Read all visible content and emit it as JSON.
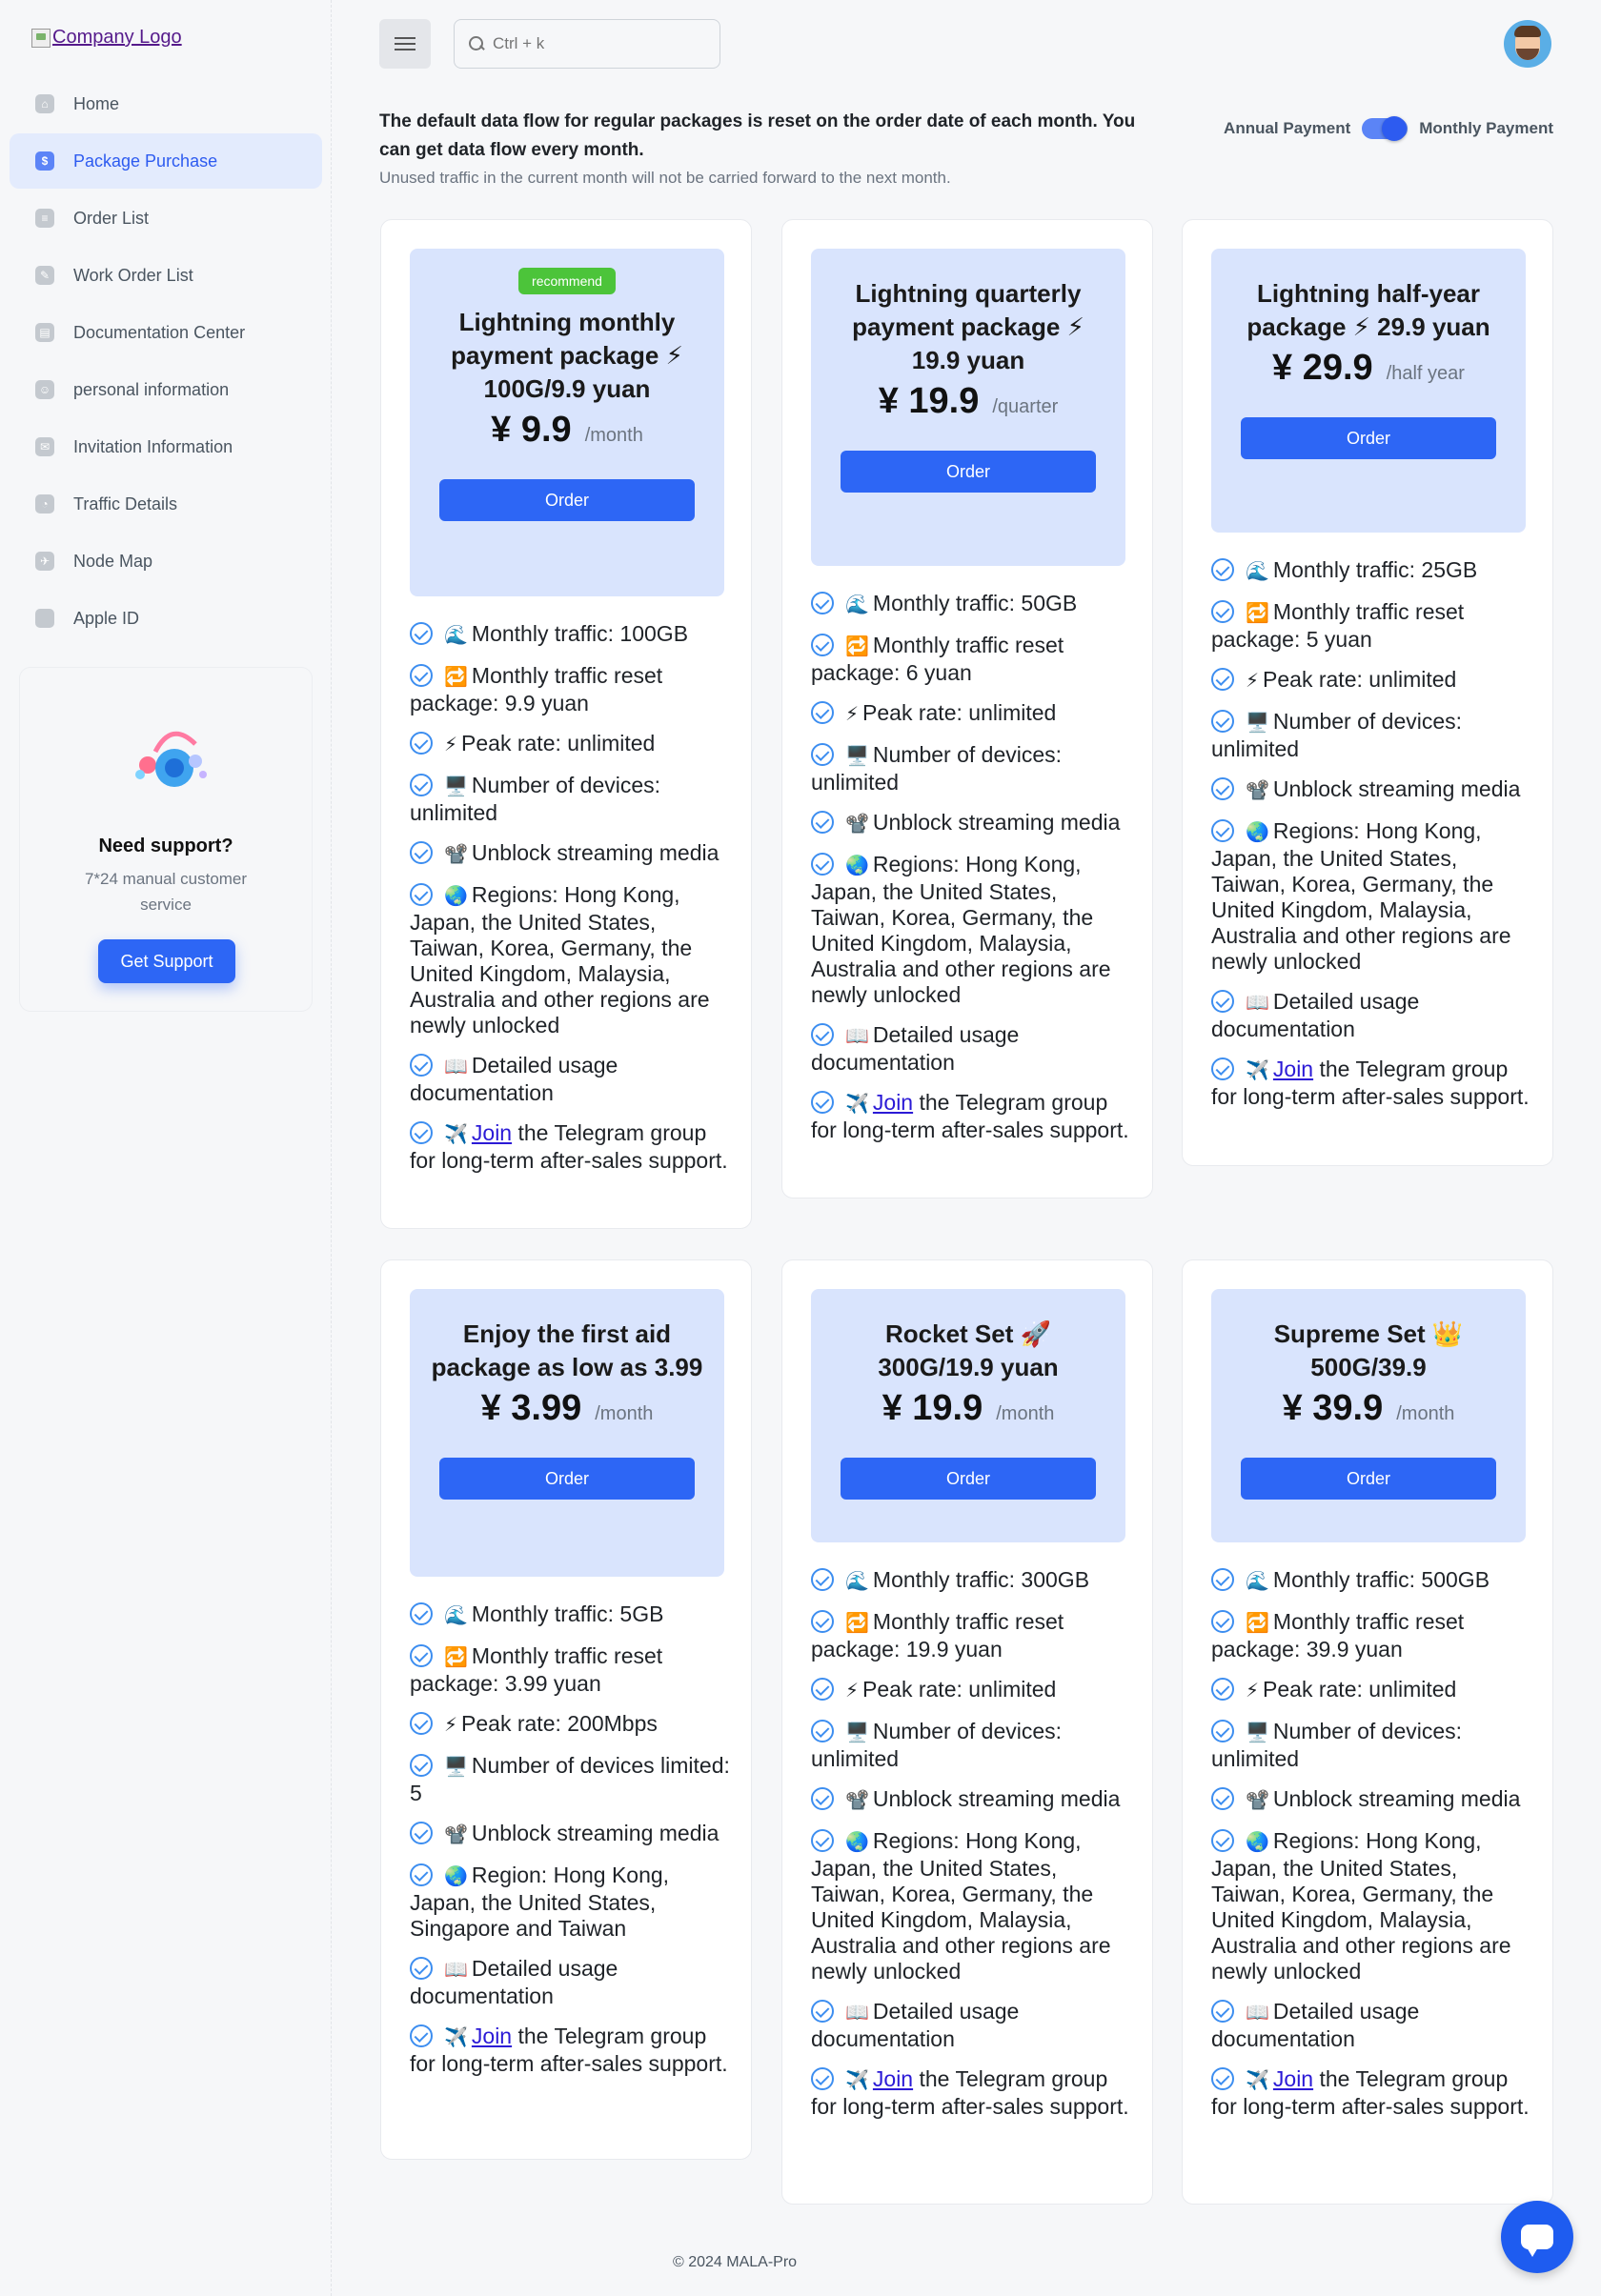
{
  "logo_alt": "Company Logo",
  "sidebar": {
    "items": [
      {
        "label": "Home",
        "icon": "home-icon"
      },
      {
        "label": "Package Purchase",
        "icon": "dollar-icon",
        "active": true
      },
      {
        "label": "Order List",
        "icon": "list-icon"
      },
      {
        "label": "Work Order List",
        "icon": "ticket-icon"
      },
      {
        "label": "Documentation Center",
        "icon": "document-icon"
      },
      {
        "label": "personal information",
        "icon": "user-icon"
      },
      {
        "label": "Invitation Information",
        "icon": "invite-icon"
      },
      {
        "label": "Traffic Details",
        "icon": "pie-chart-icon"
      },
      {
        "label": "Node Map",
        "icon": "plane-icon"
      },
      {
        "label": "Apple ID",
        "icon": "apple-icon"
      }
    ]
  },
  "support": {
    "title": "Need support?",
    "subtitle": "7*24 manual customer service",
    "button": "Get Support"
  },
  "search": {
    "placeholder": "Ctrl + k"
  },
  "intro": {
    "main": "The default data flow for regular packages is reset on the order date of each month. You can get data flow every month.",
    "sub": "Unused traffic in the current month will not be carried forward to the next month."
  },
  "toggle": {
    "left": "Annual Payment",
    "right": "Monthly Payment",
    "state": "monthly"
  },
  "order_label": "Order",
  "footer": "© 2024 MALA-Pro",
  "colors": {
    "accent": "#2d66f5",
    "card_head": "#d9e4fd",
    "badge": "#4cc43a"
  },
  "plans": [
    {
      "badge": "recommend",
      "title": "Lightning monthly payment package ⚡ 100G/9.9 yuan",
      "price": "¥ 9.9",
      "period": "/month",
      "features": [
        {
          "emoji": "🌊",
          "text": "Monthly traffic: 100GB"
        },
        {
          "emoji": "🔁",
          "text": "Monthly traffic reset package: 9.9 yuan"
        },
        {
          "emoji": "⚡",
          "text": "Peak rate: unlimited"
        },
        {
          "emoji": "🖥️",
          "text": "Number of devices: unlimited"
        },
        {
          "emoji": "📽️",
          "text": "Unblock streaming media"
        },
        {
          "emoji": "🌏",
          "text": "Regions: Hong Kong, Japan, the United States, Taiwan, Korea, Germany, the United Kingdom, Malaysia, Australia and other regions are newly unlocked"
        },
        {
          "emoji": "📖",
          "text": "Detailed usage documentation"
        },
        {
          "emoji": "✈️",
          "link": "Join",
          "text": " the Telegram group for long-term after-sales support."
        }
      ]
    },
    {
      "badge": "",
      "title": "Lightning quarterly payment package ⚡ 19.9 yuan",
      "price": "¥ 19.9",
      "period": "/quarter",
      "features": [
        {
          "emoji": "🌊",
          "text": "Monthly traffic: 50GB"
        },
        {
          "emoji": "🔁",
          "text": "Monthly traffic reset package: 6 yuan"
        },
        {
          "emoji": "⚡",
          "text": "Peak rate: unlimited"
        },
        {
          "emoji": "🖥️",
          "text": "Number of devices: unlimited"
        },
        {
          "emoji": "📽️",
          "text": "Unblock streaming media"
        },
        {
          "emoji": "🌏",
          "text": "Regions: Hong Kong, Japan, the United States, Taiwan, Korea, Germany, the United Kingdom, Malaysia, Australia and other regions are newly unlocked"
        },
        {
          "emoji": "📖",
          "text": "Detailed usage documentation"
        },
        {
          "emoji": "✈️",
          "link": "Join",
          "text": " the Telegram group for long-term after-sales support."
        }
      ]
    },
    {
      "badge": "",
      "title": "Lightning half-year package ⚡ 29.9 yuan",
      "price": "¥ 29.9",
      "period": "/half year",
      "features": [
        {
          "emoji": "🌊",
          "text": "Monthly traffic: 25GB"
        },
        {
          "emoji": "🔁",
          "text": "Monthly traffic reset package: 5 yuan"
        },
        {
          "emoji": "⚡",
          "text": "Peak rate: unlimited"
        },
        {
          "emoji": "🖥️",
          "text": "Number of devices: unlimited"
        },
        {
          "emoji": "📽️",
          "text": "Unblock streaming media"
        },
        {
          "emoji": "🌏",
          "text": "Regions: Hong Kong, Japan, the United States, Taiwan, Korea, Germany, the United Kingdom, Malaysia, Australia and other regions are newly unlocked"
        },
        {
          "emoji": "📖",
          "text": "Detailed usage documentation"
        },
        {
          "emoji": "✈️",
          "link": "Join",
          "text": " the Telegram group for long-term after-sales support."
        }
      ]
    },
    {
      "badge": "",
      "title": "Enjoy the first aid package as low as 3.99",
      "price": "¥ 3.99",
      "period": "/month",
      "features": [
        {
          "emoji": "🌊",
          "text": "Monthly traffic: 5GB"
        },
        {
          "emoji": "🔁",
          "text": "Monthly traffic reset package: 3.99 yuan"
        },
        {
          "emoji": "⚡",
          "text": "Peak rate: 200Mbps"
        },
        {
          "emoji": "🖥️",
          "text": "Number of devices limited: 5"
        },
        {
          "emoji": "📽️",
          "text": "Unblock streaming media"
        },
        {
          "emoji": "🌏",
          "text": "Region: Hong Kong, Japan, the United States, Singapore and Taiwan"
        },
        {
          "emoji": "📖",
          "text": "Detailed usage documentation"
        },
        {
          "emoji": "✈️",
          "link": "Join",
          "text": " the Telegram group for long-term after-sales support."
        }
      ]
    },
    {
      "badge": "",
      "title": "Rocket Set 🚀 300G/19.9 yuan",
      "price": "¥ 19.9",
      "period": "/month",
      "features": [
        {
          "emoji": "🌊",
          "text": "Monthly traffic: 300GB"
        },
        {
          "emoji": "🔁",
          "text": "Monthly traffic reset package: 19.9 yuan"
        },
        {
          "emoji": "⚡",
          "text": "Peak rate: unlimited"
        },
        {
          "emoji": "🖥️",
          "text": "Number of devices: unlimited"
        },
        {
          "emoji": "📽️",
          "text": "Unblock streaming media"
        },
        {
          "emoji": "🌏",
          "text": "Regions: Hong Kong, Japan, the United States, Taiwan, Korea, Germany, the United Kingdom, Malaysia, Australia and other regions are newly unlocked"
        },
        {
          "emoji": "📖",
          "text": "Detailed usage documentation"
        },
        {
          "emoji": "✈️",
          "link": "Join",
          "text": " the Telegram group for long-term after-sales support."
        }
      ]
    },
    {
      "badge": "",
      "title": "Supreme Set 👑 500G/39.9",
      "price": "¥ 39.9",
      "period": "/month",
      "features": [
        {
          "emoji": "🌊",
          "text": "Monthly traffic: 500GB"
        },
        {
          "emoji": "🔁",
          "text": "Monthly traffic reset package: 39.9 yuan"
        },
        {
          "emoji": "⚡",
          "text": "Peak rate: unlimited"
        },
        {
          "emoji": "🖥️",
          "text": "Number of devices: unlimited"
        },
        {
          "emoji": "📽️",
          "text": "Unblock streaming media"
        },
        {
          "emoji": "🌏",
          "text": "Regions: Hong Kong, Japan, the United States, Taiwan, Korea, Germany, the United Kingdom, Malaysia, Australia and other regions are newly unlocked"
        },
        {
          "emoji": "📖",
          "text": "Detailed usage documentation"
        },
        {
          "emoji": "✈️",
          "link": "Join",
          "text": " the Telegram group for long-term after-sales support."
        }
      ]
    }
  ]
}
